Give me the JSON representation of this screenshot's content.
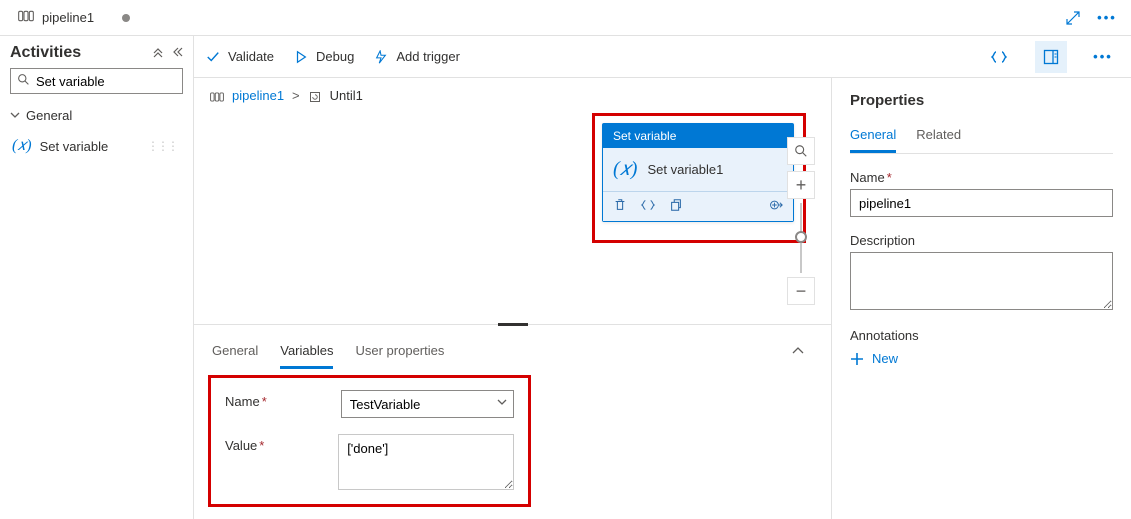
{
  "tab": {
    "title": "pipeline1"
  },
  "sidebar": {
    "title": "Activities",
    "search_value": "Set variable",
    "group_label": "General",
    "items": [
      {
        "label": "Set variable"
      }
    ]
  },
  "toolbar": {
    "validate": "Validate",
    "debug": "Debug",
    "add_trigger": "Add trigger"
  },
  "breadcrumb": {
    "root": "pipeline1",
    "child": "Until1"
  },
  "activity": {
    "type_label": "Set variable",
    "name": "Set variable1"
  },
  "bottom": {
    "tabs": {
      "general": "General",
      "variables": "Variables",
      "user_properties": "User properties"
    },
    "name_label": "Name",
    "value_label": "Value",
    "name_value": "TestVariable",
    "value_value": "['done']"
  },
  "props": {
    "title": "Properties",
    "tabs": {
      "general": "General",
      "related": "Related"
    },
    "name_label": "Name",
    "name_value": "pipeline1",
    "description_label": "Description",
    "description_value": "",
    "annotations_label": "Annotations",
    "new_label": "New"
  }
}
